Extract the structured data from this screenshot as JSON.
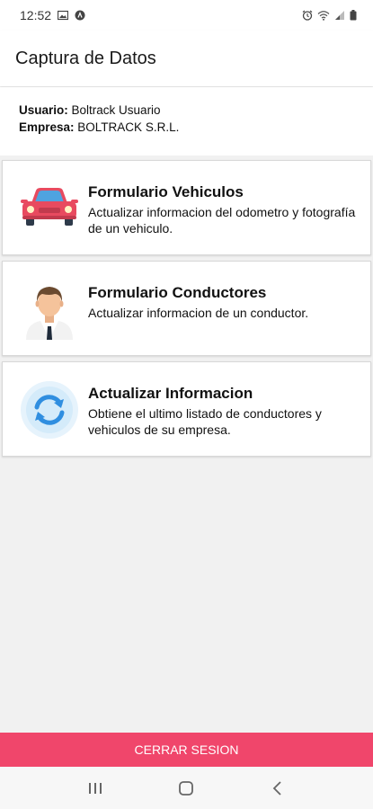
{
  "status_bar": {
    "time": "12:52",
    "icons": [
      "gallery-icon",
      "app-notification-icon",
      "alarm-icon",
      "wifi-icon",
      "signal-icon",
      "battery-icon"
    ]
  },
  "app_bar": {
    "title": "Captura de Datos"
  },
  "user_info": {
    "user_label": "Usuario:",
    "user_value": "Boltrack Usuario",
    "company_label": "Empresa:",
    "company_value": "BOLTRACK S.R.L."
  },
  "cards": [
    {
      "title": "Formulario Vehiculos",
      "description": "Actualizar informacion del odometro y fotografía de un vehiculo.",
      "icon": "car-icon"
    },
    {
      "title": "Formulario Conductores",
      "description": "Actualizar informacion de un conductor.",
      "icon": "driver-avatar-icon"
    },
    {
      "title": "Actualizar Informacion",
      "description": "Obtiene el ultimo listado de conductores y vehiculos de su empresa.",
      "icon": "refresh-icon"
    }
  ],
  "logout": {
    "label": "CERRAR SESION",
    "color": "#f0466b"
  },
  "nav_bar": {
    "icons": [
      "recent-apps-icon",
      "home-icon",
      "back-icon"
    ]
  }
}
